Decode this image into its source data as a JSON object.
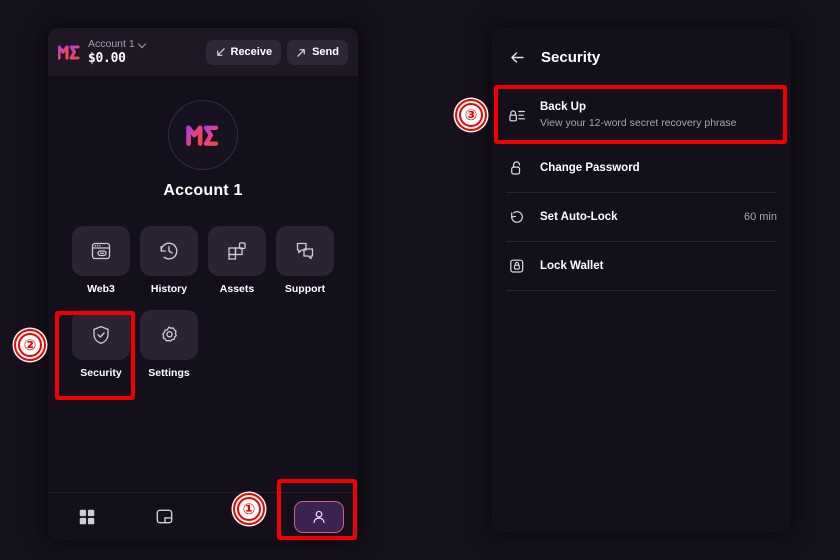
{
  "theme": {
    "page_bg": "#16121d",
    "panel_bg": "#14101b",
    "accent_red": "#f20000",
    "brand_pink": "#e8447a",
    "brand_purple": "#a23bd6",
    "tile_bg": "#2a2333",
    "active_nav_bg": "#3a2350",
    "active_nav_border": "#c2657f",
    "text_primary": "#ffffff",
    "text_muted": "#a8a3b2"
  },
  "wallet": {
    "header": {
      "logo_icon": "me-logo-icon",
      "account_name": "Account 1",
      "account_chevron_icon": "chevron-down-icon",
      "balance": "$0.00",
      "receive_label": "Receive",
      "receive_icon": "arrow-down-left-icon",
      "send_label": "Send",
      "send_icon": "arrow-up-right-icon"
    },
    "profile": {
      "avatar_icon": "me-logo-icon",
      "name": "Account 1"
    },
    "tiles": [
      {
        "label": "Web3",
        "icon": "browser-link-icon"
      },
      {
        "label": "History",
        "icon": "clock-rewind-icon"
      },
      {
        "label": "Assets",
        "icon": "blocks-icon"
      },
      {
        "label": "Support",
        "icon": "chat-bubbles-icon"
      },
      {
        "label": "Security",
        "icon": "shield-check-icon"
      },
      {
        "label": "Settings",
        "icon": "gear-icon"
      }
    ],
    "bottom_nav": [
      {
        "name": "apps",
        "icon": "grid-squares-icon",
        "active": false
      },
      {
        "name": "wallet",
        "icon": "wallet-card-icon",
        "active": false
      },
      {
        "name": "swap",
        "icon": "swap-arrows-icon",
        "active": false
      },
      {
        "name": "profile",
        "icon": "person-icon",
        "active": true
      }
    ]
  },
  "security": {
    "back_icon": "arrow-left-icon",
    "title": "Security",
    "rows": [
      {
        "label": "Back Up",
        "sub": "View your 12-word secret recovery phrase",
        "value": "",
        "icon": "lock-lines-icon"
      },
      {
        "label": "Change Password",
        "sub": "",
        "value": "",
        "icon": "unlocked-padlock-icon"
      },
      {
        "label": "Set Auto-Lock",
        "sub": "",
        "value": "60 min",
        "icon": "rotate-ccw-icon"
      },
      {
        "label": "Lock Wallet",
        "sub": "",
        "value": "",
        "icon": "boxed-lock-icon"
      }
    ]
  },
  "annotations": {
    "steps": [
      {
        "number": "①",
        "target": "profile-tab"
      },
      {
        "number": "②",
        "target": "security-tile"
      },
      {
        "number": "③",
        "target": "backup-row"
      }
    ],
    "highlight_color": "#f20000"
  }
}
